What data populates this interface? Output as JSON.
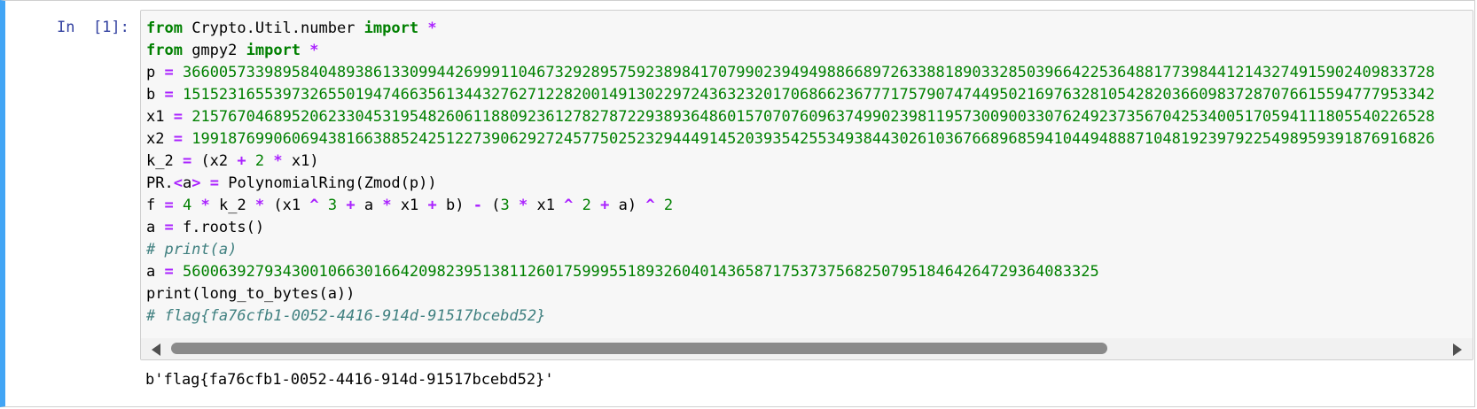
{
  "cell": {
    "prompt": "In  [1]:",
    "lines": [
      [
        {
          "t": "kw",
          "v": "from"
        },
        {
          "t": "",
          "v": " Crypto.Util.number "
        },
        {
          "t": "kw",
          "v": "import"
        },
        {
          "t": "",
          "v": " "
        },
        {
          "t": "op",
          "v": "*"
        }
      ],
      [
        {
          "t": "kw",
          "v": "from"
        },
        {
          "t": "",
          "v": " gmpy2 "
        },
        {
          "t": "kw",
          "v": "import"
        },
        {
          "t": "",
          "v": " "
        },
        {
          "t": "op",
          "v": "*"
        }
      ],
      [
        {
          "t": "",
          "v": "p "
        },
        {
          "t": "op",
          "v": "="
        },
        {
          "t": "",
          "v": " "
        },
        {
          "t": "num",
          "v": "366005733989584048938613309944269991104673292895759238984170799023949498866897263388189033285039664225364881773984412143274915902409833728"
        }
      ],
      [
        {
          "t": "",
          "v": "b "
        },
        {
          "t": "op",
          "v": "="
        },
        {
          "t": "",
          "v": " "
        },
        {
          "t": "num",
          "v": "151523165539732655019474663561344327627122820014913022972436323201706866236777175790747449502169763281054282036609837287076615594777953342"
        }
      ],
      [
        {
          "t": "",
          "v": "x1 "
        },
        {
          "t": "op",
          "v": "="
        },
        {
          "t": "",
          "v": " "
        },
        {
          "t": "num",
          "v": "21576704689520623304531954826061188092361278278722938936486015707076096374990239811957300900330762492373567042534005170594111805540226528"
        }
      ],
      [
        {
          "t": "",
          "v": "x2 "
        },
        {
          "t": "op",
          "v": "="
        },
        {
          "t": "",
          "v": " "
        },
        {
          "t": "num",
          "v": "19918769906069438166388524251227390629272457750252329444914520393542553493844302610367668968594104494888710481923979225498959391876916826"
        }
      ],
      [
        {
          "t": "",
          "v": "k_2 "
        },
        {
          "t": "op",
          "v": "="
        },
        {
          "t": "",
          "v": " (x2 "
        },
        {
          "t": "op",
          "v": "+"
        },
        {
          "t": "",
          "v": " "
        },
        {
          "t": "num",
          "v": "2"
        },
        {
          "t": "",
          "v": " "
        },
        {
          "t": "op",
          "v": "*"
        },
        {
          "t": "",
          "v": " x1)"
        }
      ],
      [
        {
          "t": "",
          "v": "PR."
        },
        {
          "t": "op",
          "v": "<"
        },
        {
          "t": "",
          "v": "a"
        },
        {
          "t": "op",
          "v": ">"
        },
        {
          "t": "",
          "v": " "
        },
        {
          "t": "op",
          "v": "="
        },
        {
          "t": "",
          "v": " PolynomialRing(Zmod(p))"
        }
      ],
      [
        {
          "t": "",
          "v": "f "
        },
        {
          "t": "op",
          "v": "="
        },
        {
          "t": "",
          "v": " "
        },
        {
          "t": "num",
          "v": "4"
        },
        {
          "t": "",
          "v": " "
        },
        {
          "t": "op",
          "v": "*"
        },
        {
          "t": "",
          "v": " k_2 "
        },
        {
          "t": "op",
          "v": "*"
        },
        {
          "t": "",
          "v": " (x1 "
        },
        {
          "t": "op",
          "v": "^"
        },
        {
          "t": "",
          "v": " "
        },
        {
          "t": "num",
          "v": "3"
        },
        {
          "t": "",
          "v": " "
        },
        {
          "t": "op",
          "v": "+"
        },
        {
          "t": "",
          "v": " a "
        },
        {
          "t": "op",
          "v": "*"
        },
        {
          "t": "",
          "v": " x1 "
        },
        {
          "t": "op",
          "v": "+"
        },
        {
          "t": "",
          "v": " b) "
        },
        {
          "t": "op",
          "v": "-"
        },
        {
          "t": "",
          "v": " ("
        },
        {
          "t": "num",
          "v": "3"
        },
        {
          "t": "",
          "v": " "
        },
        {
          "t": "op",
          "v": "*"
        },
        {
          "t": "",
          "v": " x1 "
        },
        {
          "t": "op",
          "v": "^"
        },
        {
          "t": "",
          "v": " "
        },
        {
          "t": "num",
          "v": "2"
        },
        {
          "t": "",
          "v": " "
        },
        {
          "t": "op",
          "v": "+"
        },
        {
          "t": "",
          "v": " a) "
        },
        {
          "t": "op",
          "v": "^"
        },
        {
          "t": "",
          "v": " "
        },
        {
          "t": "num",
          "v": "2"
        }
      ],
      [
        {
          "t": "",
          "v": "a "
        },
        {
          "t": "op",
          "v": "="
        },
        {
          "t": "",
          "v": " f.roots()"
        }
      ],
      [
        {
          "t": "cm",
          "v": "# print(a)"
        }
      ],
      [
        {
          "t": "",
          "v": "a "
        },
        {
          "t": "op",
          "v": "="
        },
        {
          "t": "",
          "v": " "
        },
        {
          "t": "num",
          "v": "56006392793430010663016642098239513811260175999551893260401436587175373756825079518464264729364083325"
        }
      ],
      [
        {
          "t": "",
          "v": "print(long_to_bytes(a))"
        }
      ],
      [
        {
          "t": "cm",
          "v": "# flag{fa76cfb1-0052-4416-914d-91517bcebd52}"
        }
      ]
    ],
    "output": "b'flag{fa76cfb1-0052-4416-914d-91517bcebd52}'"
  }
}
